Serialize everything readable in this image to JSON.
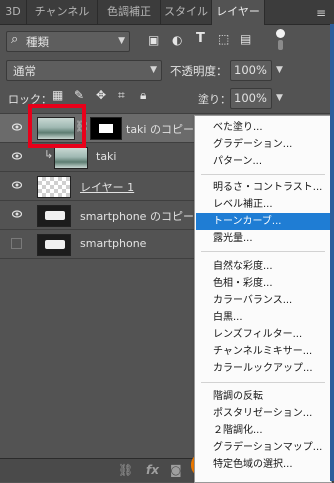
{
  "tabs": [
    "3D",
    "チャンネル",
    "色調補正",
    "スタイル",
    "レイヤー"
  ],
  "tab_menu_icon": "panel-menu-icon",
  "filter": {
    "label": "種類",
    "toggle_icon": "filter-toggle-icon"
  },
  "blend": {
    "mode": "通常",
    "opacity_label": "不透明度：",
    "opacity_value": "100%"
  },
  "lock": {
    "label": "ロック：",
    "fill_label": "塗り：",
    "fill_value": "100%"
  },
  "layers": [
    {
      "name": "taki のコピー",
      "visible": true,
      "selected": true
    },
    {
      "name": "taki",
      "visible": true,
      "selected": false
    },
    {
      "name": "レイヤー 1",
      "visible": true,
      "selected": false
    },
    {
      "name": "smartphone のコピー",
      "visible": true,
      "selected": false
    },
    {
      "name": "smartphone",
      "visible": false,
      "selected": false
    }
  ],
  "bottom_icons": [
    "link-icon",
    "fx-icon",
    "mask-icon",
    "adjustment-icon"
  ],
  "menu": {
    "group1": [
      "べた塗り...",
      "グラデーション...",
      "パターン..."
    ],
    "group2": [
      "明るさ・コントラスト...",
      "レベル補正...",
      "トーンカーブ...",
      "露光量..."
    ],
    "group3": [
      "自然な彩度...",
      "色相・彩度...",
      "カラーバランス...",
      "白黒...",
      "レンズフィルター...",
      "チャンネルミキサー...",
      "カラールックアップ..."
    ],
    "group4": [
      "階調の反転",
      "ポスタリゼーション...",
      "２階調化...",
      "グラデーションマップ...",
      "特定色域の選択..."
    ],
    "highlighted": "トーンカーブ..."
  },
  "colors": {
    "highlight": "#1f7dd4",
    "annotation_red": "#e8001a",
    "annotation_orange": "#f07b00"
  }
}
